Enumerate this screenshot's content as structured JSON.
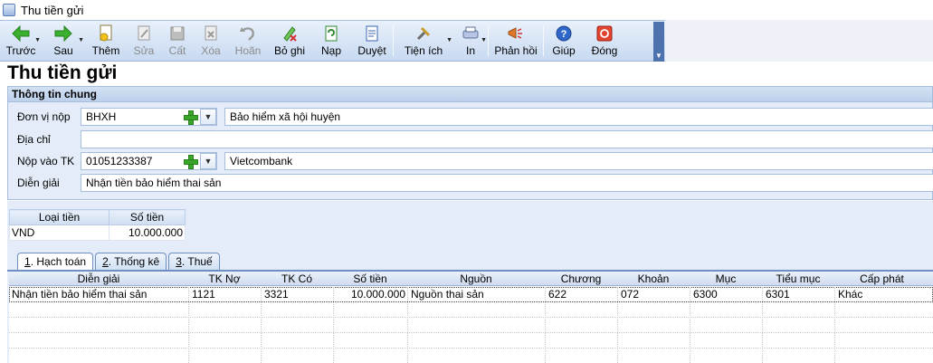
{
  "window": {
    "title": "Thu tiền gửi"
  },
  "toolbar": {
    "items": [
      {
        "label": "Trước",
        "icon": "arrow-left-icon",
        "dropdown": true,
        "disabled": false
      },
      {
        "label": "Sau",
        "icon": "arrow-right-icon",
        "dropdown": true,
        "disabled": false
      },
      {
        "label": "Thêm",
        "icon": "add-document-icon",
        "dropdown": false,
        "disabled": false
      },
      {
        "label": "Sửa",
        "icon": "edit-icon",
        "dropdown": false,
        "disabled": true
      },
      {
        "label": "Cất",
        "icon": "save-icon",
        "dropdown": false,
        "disabled": true
      },
      {
        "label": "Xóa",
        "icon": "delete-icon",
        "dropdown": false,
        "disabled": true
      },
      {
        "label": "Hoãn",
        "icon": "undo-icon",
        "dropdown": false,
        "disabled": true
      },
      {
        "label": "Bỏ ghi",
        "icon": "unpost-icon",
        "dropdown": false,
        "disabled": false
      },
      {
        "label": "Nạp",
        "icon": "reload-icon",
        "dropdown": false,
        "disabled": false
      },
      {
        "label": "Duyệt",
        "icon": "approve-icon",
        "dropdown": false,
        "disabled": false
      },
      {
        "label": "Tiện ích",
        "icon": "tools-icon",
        "dropdown": true,
        "disabled": false
      },
      {
        "label": "In",
        "icon": "print-icon",
        "dropdown": true,
        "disabled": false
      },
      {
        "label": "Phản hồi",
        "icon": "feedback-icon",
        "dropdown": false,
        "disabled": false
      },
      {
        "label": "Giúp",
        "icon": "help-icon",
        "dropdown": false,
        "disabled": false
      },
      {
        "label": "Đóng",
        "icon": "close-icon",
        "dropdown": false,
        "disabled": false
      }
    ]
  },
  "form": {
    "title": "Thu tiền gửi",
    "group_title": "Thông tin chung",
    "don_vi_nop": {
      "label": "Đơn vị nộp",
      "code": "BHXH",
      "name": "Bảo hiểm xã hội huyện"
    },
    "dia_chi": {
      "label": "Địa chỉ",
      "value": ""
    },
    "nop_vao_tk": {
      "label": "Nộp vào TK",
      "code": "01051233387",
      "name": "Vietcombank"
    },
    "dien_giai": {
      "label": "Diễn giải",
      "value": "Nhận tiền bảo hiểm thai sản"
    }
  },
  "currency_table": {
    "headers": [
      "Loại tiền",
      "Số tiền"
    ],
    "rows": [
      [
        "VND",
        "10.000.000"
      ]
    ]
  },
  "tabs": [
    {
      "key": "1",
      "label": ". Hạch toán",
      "active": true
    },
    {
      "key": "2",
      "label": ". Thống kê",
      "active": false
    },
    {
      "key": "3",
      "label": ". Thuế",
      "active": false
    }
  ],
  "grid": {
    "headers": [
      "Diễn giải",
      "TK Nợ",
      "TK Có",
      "Số tiền",
      "Nguồn",
      "Chương",
      "Khoản",
      "Mục",
      "Tiểu mục",
      "Cấp phát"
    ],
    "rows": [
      [
        "Nhận tiền bảo hiểm thai sản",
        "1121",
        "3321",
        "10.000.000",
        "Nguồn thai sản",
        "622",
        "072",
        "6300",
        "6301",
        "Khác"
      ]
    ]
  },
  "colors": {
    "toolbar": "#c7d9f1",
    "panel": "#e3ecf8",
    "accent": "#6e8fc2"
  }
}
